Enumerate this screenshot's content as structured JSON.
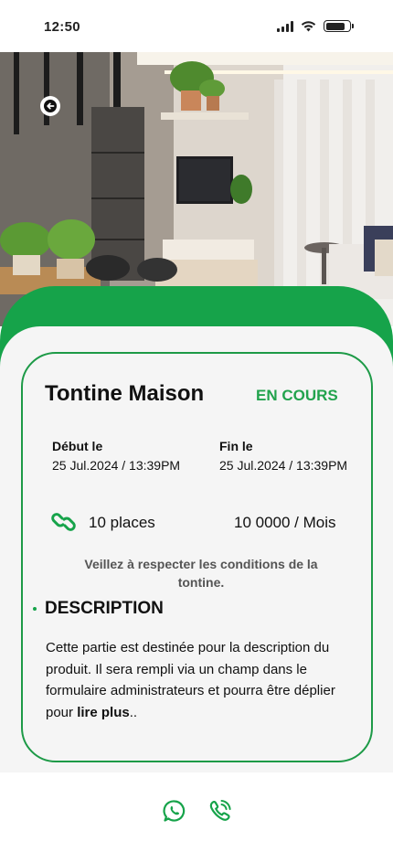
{
  "status_bar": {
    "time": "12:50",
    "battery_level": 0.8
  },
  "hero": {
    "image_icon": "living-room-photo"
  },
  "header": {
    "back_icon": "arrow-left-icon"
  },
  "tontine": {
    "title": "Tontine Maison",
    "status": "EN COURS",
    "start_label": "Début le",
    "start_date": "25 Jul.2024 / 13:39PM",
    "end_label": "Fin le",
    "end_date": "25 Jul.2024 / 13:39PM",
    "places": "10 places",
    "price": "10 0000 / Mois",
    "notice": "Veillez à respecter les conditions de la tontine."
  },
  "description": {
    "heading": "DESCRIPTION",
    "text": "Cette partie est destinée pour la description du produit. Il sera rempli via un champ dans le formulaire administrateurs et pourra être déplier pour ",
    "read_more": "lire plus",
    "ending": ".."
  },
  "actions": {
    "whatsapp_icon": "whatsapp-icon",
    "call_icon": "phone-call-icon"
  },
  "colors": {
    "accent": "#16a34a",
    "card_border": "#1d9a47",
    "status": "#22a34d",
    "sheet": "#f5f5f5"
  }
}
